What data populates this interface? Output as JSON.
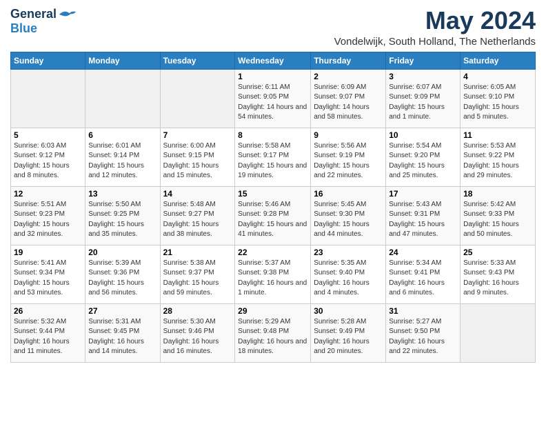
{
  "logo": {
    "general": "General",
    "blue": "Blue"
  },
  "title": {
    "month_year": "May 2024",
    "location": "Vondelwijk, South Holland, The Netherlands"
  },
  "weekdays": [
    "Sunday",
    "Monday",
    "Tuesday",
    "Wednesday",
    "Thursday",
    "Friday",
    "Saturday"
  ],
  "weeks": [
    [
      {
        "day": "",
        "info": ""
      },
      {
        "day": "",
        "info": ""
      },
      {
        "day": "",
        "info": ""
      },
      {
        "day": "1",
        "info": "Sunrise: 6:11 AM\nSunset: 9:05 PM\nDaylight: 14 hours\nand 54 minutes."
      },
      {
        "day": "2",
        "info": "Sunrise: 6:09 AM\nSunset: 9:07 PM\nDaylight: 14 hours\nand 58 minutes."
      },
      {
        "day": "3",
        "info": "Sunrise: 6:07 AM\nSunset: 9:09 PM\nDaylight: 15 hours\nand 1 minute."
      },
      {
        "day": "4",
        "info": "Sunrise: 6:05 AM\nSunset: 9:10 PM\nDaylight: 15 hours\nand 5 minutes."
      }
    ],
    [
      {
        "day": "5",
        "info": "Sunrise: 6:03 AM\nSunset: 9:12 PM\nDaylight: 15 hours\nand 8 minutes."
      },
      {
        "day": "6",
        "info": "Sunrise: 6:01 AM\nSunset: 9:14 PM\nDaylight: 15 hours\nand 12 minutes."
      },
      {
        "day": "7",
        "info": "Sunrise: 6:00 AM\nSunset: 9:15 PM\nDaylight: 15 hours\nand 15 minutes."
      },
      {
        "day": "8",
        "info": "Sunrise: 5:58 AM\nSunset: 9:17 PM\nDaylight: 15 hours\nand 19 minutes."
      },
      {
        "day": "9",
        "info": "Sunrise: 5:56 AM\nSunset: 9:19 PM\nDaylight: 15 hours\nand 22 minutes."
      },
      {
        "day": "10",
        "info": "Sunrise: 5:54 AM\nSunset: 9:20 PM\nDaylight: 15 hours\nand 25 minutes."
      },
      {
        "day": "11",
        "info": "Sunrise: 5:53 AM\nSunset: 9:22 PM\nDaylight: 15 hours\nand 29 minutes."
      }
    ],
    [
      {
        "day": "12",
        "info": "Sunrise: 5:51 AM\nSunset: 9:23 PM\nDaylight: 15 hours\nand 32 minutes."
      },
      {
        "day": "13",
        "info": "Sunrise: 5:50 AM\nSunset: 9:25 PM\nDaylight: 15 hours\nand 35 minutes."
      },
      {
        "day": "14",
        "info": "Sunrise: 5:48 AM\nSunset: 9:27 PM\nDaylight: 15 hours\nand 38 minutes."
      },
      {
        "day": "15",
        "info": "Sunrise: 5:46 AM\nSunset: 9:28 PM\nDaylight: 15 hours\nand 41 minutes."
      },
      {
        "day": "16",
        "info": "Sunrise: 5:45 AM\nSunset: 9:30 PM\nDaylight: 15 hours\nand 44 minutes."
      },
      {
        "day": "17",
        "info": "Sunrise: 5:43 AM\nSunset: 9:31 PM\nDaylight: 15 hours\nand 47 minutes."
      },
      {
        "day": "18",
        "info": "Sunrise: 5:42 AM\nSunset: 9:33 PM\nDaylight: 15 hours\nand 50 minutes."
      }
    ],
    [
      {
        "day": "19",
        "info": "Sunrise: 5:41 AM\nSunset: 9:34 PM\nDaylight: 15 hours\nand 53 minutes."
      },
      {
        "day": "20",
        "info": "Sunrise: 5:39 AM\nSunset: 9:36 PM\nDaylight: 15 hours\nand 56 minutes."
      },
      {
        "day": "21",
        "info": "Sunrise: 5:38 AM\nSunset: 9:37 PM\nDaylight: 15 hours\nand 59 minutes."
      },
      {
        "day": "22",
        "info": "Sunrise: 5:37 AM\nSunset: 9:38 PM\nDaylight: 16 hours\nand 1 minute."
      },
      {
        "day": "23",
        "info": "Sunrise: 5:35 AM\nSunset: 9:40 PM\nDaylight: 16 hours\nand 4 minutes."
      },
      {
        "day": "24",
        "info": "Sunrise: 5:34 AM\nSunset: 9:41 PM\nDaylight: 16 hours\nand 6 minutes."
      },
      {
        "day": "25",
        "info": "Sunrise: 5:33 AM\nSunset: 9:43 PM\nDaylight: 16 hours\nand 9 minutes."
      }
    ],
    [
      {
        "day": "26",
        "info": "Sunrise: 5:32 AM\nSunset: 9:44 PM\nDaylight: 16 hours\nand 11 minutes."
      },
      {
        "day": "27",
        "info": "Sunrise: 5:31 AM\nSunset: 9:45 PM\nDaylight: 16 hours\nand 14 minutes."
      },
      {
        "day": "28",
        "info": "Sunrise: 5:30 AM\nSunset: 9:46 PM\nDaylight: 16 hours\nand 16 minutes."
      },
      {
        "day": "29",
        "info": "Sunrise: 5:29 AM\nSunset: 9:48 PM\nDaylight: 16 hours\nand 18 minutes."
      },
      {
        "day": "30",
        "info": "Sunrise: 5:28 AM\nSunset: 9:49 PM\nDaylight: 16 hours\nand 20 minutes."
      },
      {
        "day": "31",
        "info": "Sunrise: 5:27 AM\nSunset: 9:50 PM\nDaylight: 16 hours\nand 22 minutes."
      },
      {
        "day": "",
        "info": ""
      }
    ]
  ]
}
